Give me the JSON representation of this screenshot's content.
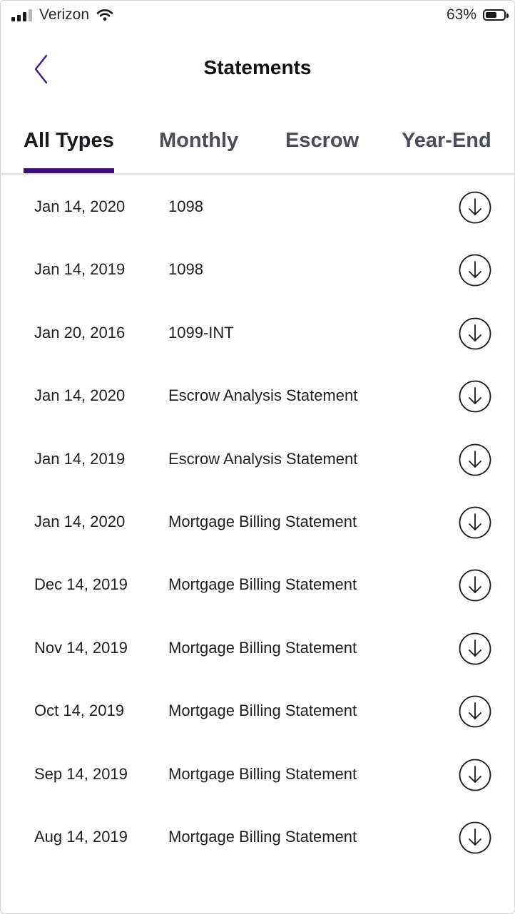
{
  "status_bar": {
    "carrier": "Verizon",
    "battery_percent": "63%",
    "battery_level": 0.63,
    "icons": [
      "signal-icon",
      "wifi-icon",
      "battery-icon"
    ]
  },
  "header": {
    "title": "Statements",
    "back_icon": "chevron-left-icon"
  },
  "tabs": [
    {
      "label": "All Types",
      "active": true
    },
    {
      "label": "Monthly",
      "active": false
    },
    {
      "label": "Escrow",
      "active": false
    },
    {
      "label": "Year-End",
      "active": false
    }
  ],
  "colors": {
    "accent": "#3b0f7a",
    "tab_inactive": "#4a4d57"
  },
  "statements": [
    {
      "date": "Jan 14, 2020",
      "type": "1098"
    },
    {
      "date": "Jan 14, 2019",
      "type": "1098"
    },
    {
      "date": "Jan 20, 2016",
      "type": "1099-INT"
    },
    {
      "date": "Jan 14, 2020",
      "type": "Escrow Analysis Statement"
    },
    {
      "date": "Jan 14, 2019",
      "type": "Escrow Analysis Statement"
    },
    {
      "date": "Jan 14, 2020",
      "type": "Mortgage Billing Statement"
    },
    {
      "date": "Dec 14, 2019",
      "type": "Mortgage Billing Statement"
    },
    {
      "date": "Nov 14, 2019",
      "type": "Mortgage Billing Statement"
    },
    {
      "date": "Oct 14, 2019",
      "type": "Mortgage Billing Statement"
    },
    {
      "date": "Sep 14, 2019",
      "type": "Mortgage Billing Statement"
    },
    {
      "date": "Aug 14, 2019",
      "type": "Mortgage Billing Statement"
    }
  ],
  "row_action_icon": "download-icon"
}
